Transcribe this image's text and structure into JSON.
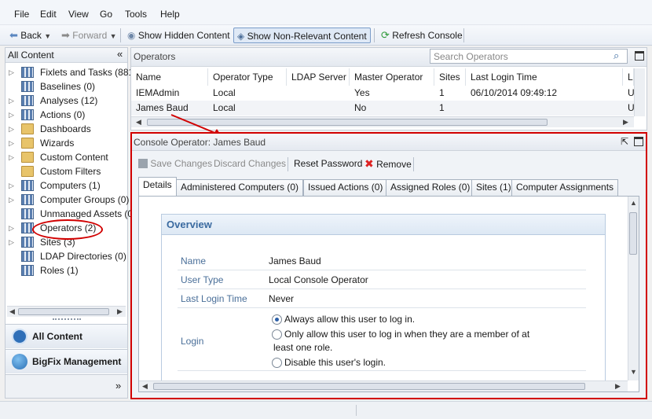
{
  "menu": [
    "File",
    "Edit",
    "View",
    "Go",
    "Tools",
    "Help"
  ],
  "toolbar": {
    "back": "Back",
    "forward": "Forward",
    "show_hidden": "Show Hidden Content",
    "show_non_relevant": "Show Non-Relevant Content",
    "refresh": "Refresh Console"
  },
  "left_panel": {
    "title": "All Content",
    "collapse_glyph": "«",
    "tree": [
      {
        "label": "Fixlets and Tasks (881",
        "icon": "grid-icon",
        "expandable": true
      },
      {
        "label": "Baselines (0)",
        "icon": "grid-icon",
        "expandable": false
      },
      {
        "label": "Analyses (12)",
        "icon": "analysis-icon",
        "expandable": true
      },
      {
        "label": "Actions (0)",
        "icon": "action-icon",
        "expandable": true
      },
      {
        "label": "Dashboards",
        "icon": "folder-icon",
        "expandable": true
      },
      {
        "label": "Wizards",
        "icon": "folder-icon",
        "expandable": true
      },
      {
        "label": "Custom Content",
        "icon": "folder-icon",
        "expandable": true
      },
      {
        "label": "Custom Filters",
        "icon": "folder-icon",
        "expandable": false
      },
      {
        "label": "Computers (1)",
        "icon": "grid-icon",
        "expandable": true
      },
      {
        "label": "Computer Groups (0)",
        "icon": "grid-icon",
        "expandable": true
      },
      {
        "label": "Unmanaged Assets (0",
        "icon": "grid-icon",
        "expandable": false
      },
      {
        "label": "Operators (2)",
        "icon": "grid-icon",
        "expandable": true
      },
      {
        "label": "Sites (3)",
        "icon": "sites-icon",
        "expandable": true
      },
      {
        "label": "LDAP Directories (0)",
        "icon": "grid-icon",
        "expandable": false
      },
      {
        "label": "Roles (1)",
        "icon": "grid-icon",
        "expandable": false
      }
    ],
    "nav": {
      "all_content": "All Content",
      "bigfix": "BigFix Management",
      "more": "»"
    }
  },
  "operators": {
    "title": "Operators",
    "search_placeholder": "Search Operators",
    "columns": [
      "Name",
      "Operator Type",
      "LDAP Server",
      "Master Operator",
      "Sites",
      "Last Login Time",
      "L"
    ],
    "rows": [
      [
        "IEMAdmin",
        "Local",
        "",
        "Yes",
        "1",
        "06/10/2014 09:49:12",
        "U"
      ],
      [
        "James Baud",
        "Local",
        "",
        "No",
        "1",
        "",
        "U"
      ]
    ]
  },
  "detail": {
    "title": "Console Operator: James Baud",
    "save": "Save Changes",
    "discard": "Discard Changes",
    "reset": "Reset Password",
    "remove": "Remove",
    "tabs": [
      "Details",
      "Administered Computers (0)",
      "Issued Actions (0)",
      "Assigned Roles (0)",
      "Sites (1)",
      "Computer Assignments"
    ],
    "overview": {
      "heading": "Overview",
      "name_label": "Name",
      "name_value": "James Baud",
      "type_label": "User Type",
      "type_value": "Local Console Operator",
      "login_time_label": "Last Login Time",
      "login_time_value": "Never",
      "login_label": "Login",
      "opt1": "Always allow this user to log in.",
      "opt2a": "Only allow this user to log in when they are a member of at",
      "opt2b": "least one role.",
      "opt3": "Disable this user's login."
    }
  },
  "colors": {
    "highlight_red": "#d10000",
    "accent_blue": "#3a6aa0"
  }
}
